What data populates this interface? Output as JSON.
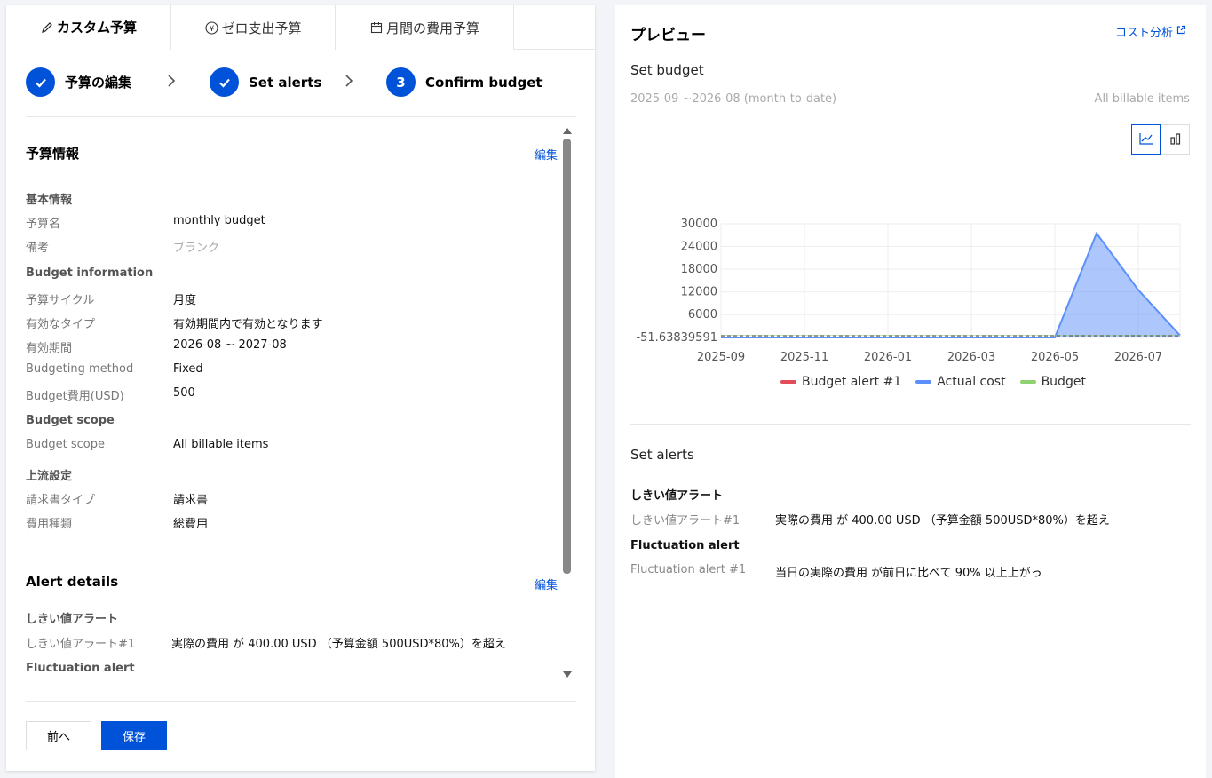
{
  "tabs": [
    {
      "label": "カスタム予算",
      "icon": "pencil-icon"
    },
    {
      "label": "ゼロ支出予算",
      "icon": "yen-icon"
    },
    {
      "label": "月間の費用予算",
      "icon": "calendar-icon"
    }
  ],
  "steps": [
    {
      "label": "予算の編集",
      "state": "done"
    },
    {
      "label": "Set alerts",
      "state": "done"
    },
    {
      "label": "Confirm budget",
      "number": "3",
      "state": "current"
    }
  ],
  "budget_info": {
    "title": "予算情報",
    "edit": "編集",
    "basic_title": "基本情報",
    "name_label": "予算名",
    "name_value": "monthly budget",
    "remark_label": "備考",
    "remark_value": "ブランク",
    "info_title": "Budget information",
    "cycle_label": "予算サイクル",
    "cycle_value": "月度",
    "type_label": "有効なタイプ",
    "type_value": "有効期間内で有効となります",
    "period_label": "有効期間",
    "period_value": "2026-08 ~ 2027-08",
    "method_label": "Budgeting method",
    "method_value": "Fixed",
    "cost_label": "Budget費用(USD)",
    "cost_value": "500",
    "scope_title": "Budget scope",
    "scope_label": "Budget scope",
    "scope_value": "All billable items",
    "upstream_title": "上流設定",
    "invoice_label": "請求書タイプ",
    "invoice_value": "請求書",
    "costtype_label": "費用種類",
    "costtype_value": "総費用"
  },
  "alert_details": {
    "title": "Alert details",
    "edit": "編集",
    "threshold_title": "しきい値アラート",
    "threshold_label": "しきい値アラート#1",
    "threshold_value": "実際の費用 が 400.00 USD （予算金額 500USD*80%）を超え",
    "fluct_title": "Fluctuation alert"
  },
  "buttons": {
    "prev": "前へ",
    "save": "保存"
  },
  "preview": {
    "title": "プレビュー",
    "cost_link": "コスト分析",
    "set_budget": "Set budget",
    "range": "2025-09 ~2026-08 (month-to-date)",
    "scope": "All billable items",
    "set_alerts": "Set alerts",
    "threshold_title": "しきい値アラート",
    "threshold_label": "しきい値アラート#1",
    "threshold_value": "実際の費用 が 400.00 USD （予算金額 500USD*80%）を超え",
    "fluct_title": "Fluctuation alert",
    "fluct_label": "Fluctuation alert #1",
    "fluct_value": "当日の実際の費用 が前日に比べて 90% 以上上がっ"
  },
  "colors": {
    "primary": "#0052d9",
    "alert": "#e34d59",
    "actual": "#5b8ff9",
    "budget": "#8fd16f"
  },
  "chart_data": {
    "type": "area",
    "x": [
      "2025-09",
      "2025-10",
      "2025-11",
      "2025-12",
      "2026-01",
      "2026-02",
      "2026-03",
      "2026-04",
      "2026-05",
      "2026-06",
      "2026-07",
      "2026-08"
    ],
    "x_tick_labels": [
      "2025-09",
      "2025-11",
      "2026-01",
      "2026-03",
      "2026-05",
      "2026-07"
    ],
    "y_tick_labels": [
      "-51.63839591",
      "6000",
      "12000",
      "18000",
      "24000",
      "30000"
    ],
    "ylim": [
      -51.63839591,
      30000
    ],
    "series": [
      {
        "name": "Budget alert #1",
        "color": "#e34d59",
        "values": [
          400,
          400,
          400,
          400,
          400,
          400,
          400,
          400,
          400,
          400,
          400,
          400
        ]
      },
      {
        "name": "Actual cost",
        "color": "#5b8ff9",
        "values": [
          -52,
          -52,
          -52,
          -52,
          -52,
          -52,
          -52,
          -52,
          -52,
          27500,
          12500,
          500
        ]
      },
      {
        "name": "Budget",
        "color": "#8fd16f",
        "values": [
          500,
          500,
          500,
          500,
          500,
          500,
          500,
          500,
          500,
          500,
          500,
          500
        ]
      }
    ],
    "grid": true,
    "legend": "bottom"
  }
}
